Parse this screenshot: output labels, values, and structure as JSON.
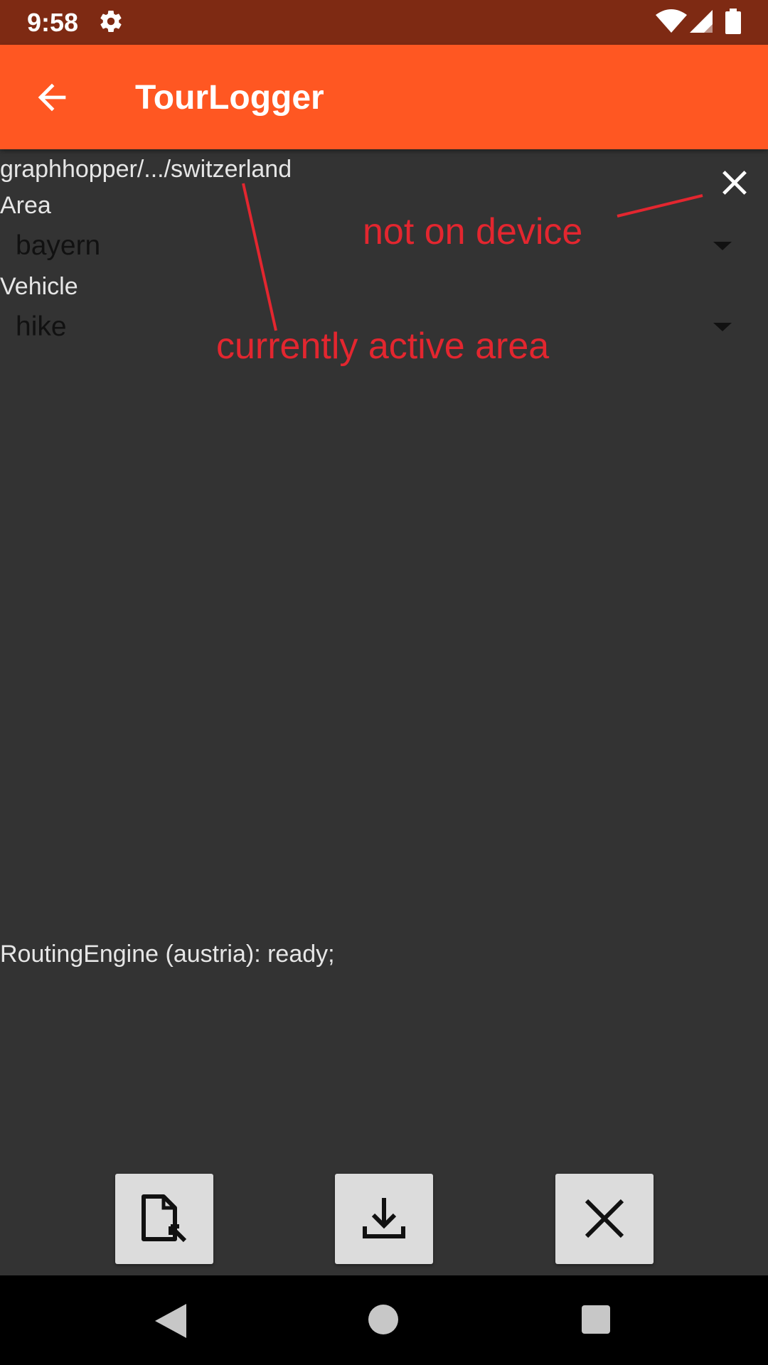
{
  "status_bar": {
    "time": "9:58",
    "icons": [
      "gear-icon",
      "wifi-icon",
      "signal-icon",
      "battery-icon"
    ]
  },
  "app_bar": {
    "title": "TourLogger",
    "back_icon": "arrow-left-icon",
    "color": "#ff5722"
  },
  "content": {
    "path_text": "graphhopper/.../switzerland",
    "area_label": "Area",
    "area_value": "bayern",
    "vehicle_label": "Vehicle",
    "vehicle_value": "hike",
    "routing_status": "RoutingEngine (austria): ready;"
  },
  "annotations": {
    "not_on_device": "not on device",
    "currently_active_area": "currently active area",
    "color": "#e3262f"
  },
  "actions": {
    "open_file_icon": "file-open-icon",
    "download_icon": "download-icon",
    "delete_icon": "close-icon"
  },
  "nav_bar": {
    "icons": [
      "nav-back-icon",
      "nav-home-icon",
      "nav-recents-icon"
    ]
  }
}
